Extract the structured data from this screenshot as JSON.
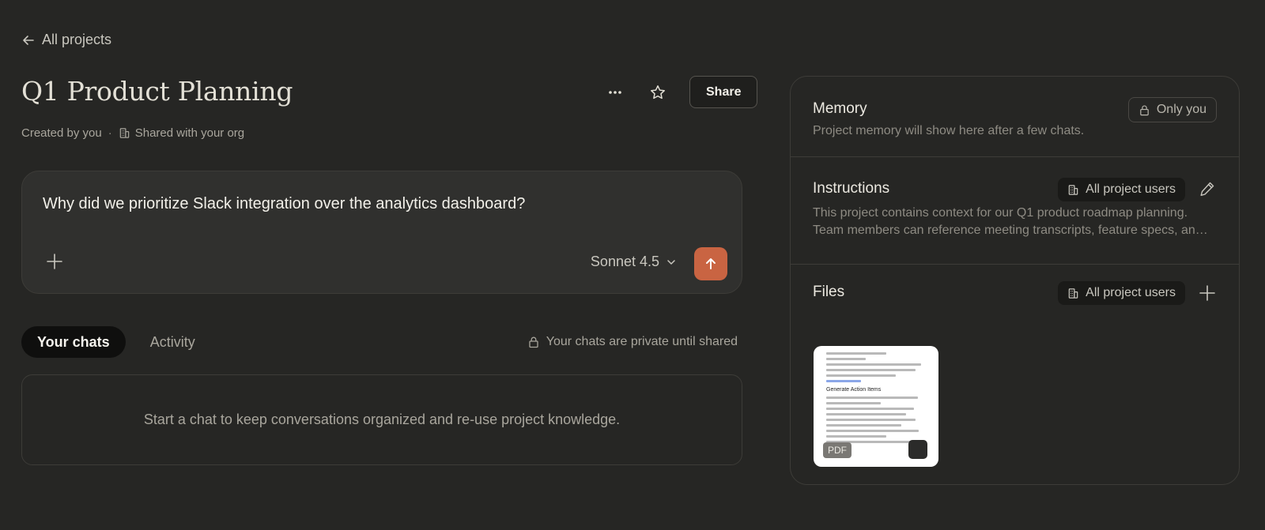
{
  "nav": {
    "back_label": "All projects"
  },
  "project": {
    "title": "Q1 Product Planning",
    "created_by": "Created by you",
    "separator": "·",
    "shared_with": "Shared with your org",
    "share_label": "Share"
  },
  "composer": {
    "text": "Why did we prioritize Slack integration over the analytics dashboard?",
    "model": "Sonnet 4.5"
  },
  "tabs": [
    {
      "label": "Your chats",
      "active": true
    },
    {
      "label": "Activity",
      "active": false
    }
  ],
  "privacy_note": "Your chats are private until shared",
  "empty_state": "Start a chat to keep conversations organized and re-use project knowledge.",
  "panel": {
    "memory": {
      "title": "Memory",
      "visibility": "Only you",
      "description": "Project memory will show here after a few chats."
    },
    "instructions": {
      "title": "Instructions",
      "visibility": "All project users",
      "description_line1": "This project contains context for our Q1 product roadmap planning.",
      "description_line2": "Team members can reference meeting transcripts, feature specs, an…"
    },
    "files": {
      "title": "Files",
      "visibility": "All project users",
      "items": [
        {
          "type": "PDF",
          "heading": "Generate Action Items"
        }
      ]
    }
  },
  "colors": {
    "background": "#262624",
    "accent": "#c96442",
    "panel_border": "#3d3c38"
  }
}
